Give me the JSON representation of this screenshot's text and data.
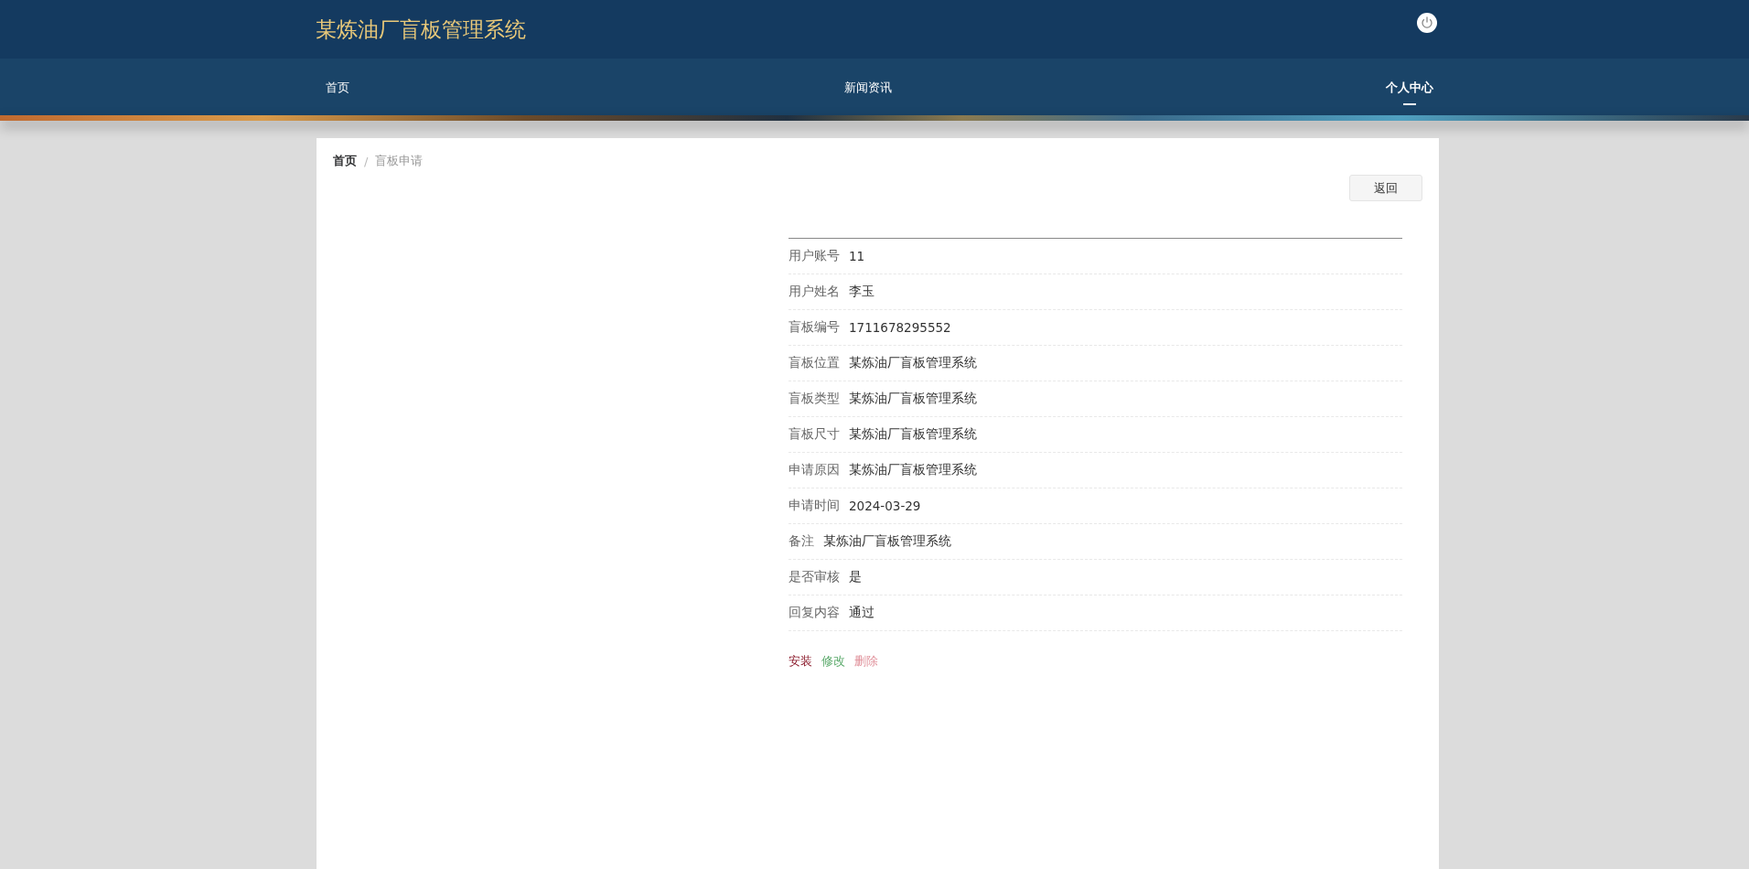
{
  "header": {
    "title": "某炼油厂盲板管理系统"
  },
  "nav": [
    {
      "label": "首页",
      "selected": false
    },
    {
      "label": "新闻资讯",
      "selected": false
    },
    {
      "label": "个人中心",
      "selected": true
    }
  ],
  "breadcrumb": [
    {
      "label": "首页",
      "current": false
    },
    {
      "label": "盲板申请",
      "current": true
    }
  ],
  "breadcrumb_separator": "/",
  "back_button": "返回",
  "details": [
    {
      "label": "用户账号",
      "value": "11"
    },
    {
      "label": "用户姓名",
      "value": "李玉"
    },
    {
      "label": "盲板编号",
      "value": "1711678295552"
    },
    {
      "label": "盲板位置",
      "value": "某炼油厂盲板管理系统"
    },
    {
      "label": "盲板类型",
      "value": "某炼油厂盲板管理系统"
    },
    {
      "label": "盲板尺寸",
      "value": "某炼油厂盲板管理系统"
    },
    {
      "label": "申请原因",
      "value": "某炼油厂盲板管理系统"
    },
    {
      "label": "申请时间",
      "value": "2024-03-29"
    },
    {
      "label": "备注",
      "value": "某炼油厂盲板管理系统"
    },
    {
      "label": "是否审核",
      "value": "是"
    },
    {
      "label": "回复内容",
      "value": "通过"
    }
  ],
  "actions": [
    {
      "label": "安装",
      "color": "#8b1a2b"
    },
    {
      "label": "修改",
      "color": "#5aa96a"
    },
    {
      "label": "删除",
      "color": "#e0909a"
    }
  ]
}
